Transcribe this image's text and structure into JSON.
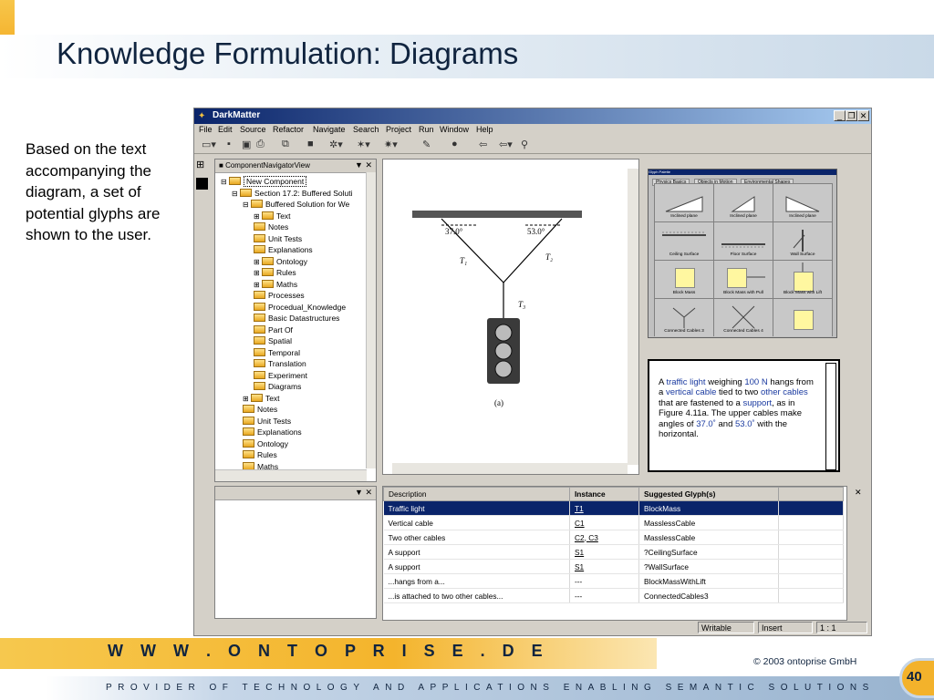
{
  "slide": {
    "title": "Knowledge Formulation: Diagrams",
    "description": "Based on the text accompanying the diagram, a set of potential glyphs are shown to the user.",
    "footer_url": "W W W . O N T O P R I S E . D E",
    "copyright": "©  2003  ontoprise GmbH",
    "tagline": "PROVIDER OF TECHNOLOGY AND APPLICATIONS ENABLING SEMANTIC SOLUTIONS",
    "page_number": "40"
  },
  "app": {
    "title": "DarkMatter",
    "menu": [
      "File",
      "Edit",
      "Source",
      "Refactor",
      "Navigate",
      "Search",
      "Project",
      "Run",
      "Window",
      "Help"
    ],
    "navigator": {
      "title": "ComponentNavigatorView",
      "tree": [
        {
          "label": "New Component",
          "level": 0,
          "selected": true
        },
        {
          "label": "Section 17.2: Buffered Soluti",
          "level": 1
        },
        {
          "label": "Buffered Solution for We",
          "level": 2
        },
        {
          "label": "Text",
          "level": 3
        },
        {
          "label": "Notes",
          "level": 3
        },
        {
          "label": "Unit Tests",
          "level": 3
        },
        {
          "label": "Explanations",
          "level": 3
        },
        {
          "label": "Ontology",
          "level": 3
        },
        {
          "label": "Rules",
          "level": 3
        },
        {
          "label": "Maths",
          "level": 3
        },
        {
          "label": "Processes",
          "level": 3
        },
        {
          "label": "Procedual_Knowledge",
          "level": 3
        },
        {
          "label": "Basic Datastructures",
          "level": 3
        },
        {
          "label": "Part Of",
          "level": 3
        },
        {
          "label": "Spatial",
          "level": 3
        },
        {
          "label": "Temporal",
          "level": 3
        },
        {
          "label": "Translation",
          "level": 3
        },
        {
          "label": "Experiment",
          "level": 3
        },
        {
          "label": "Diagrams",
          "level": 3
        },
        {
          "label": "Text",
          "level": 2
        },
        {
          "label": "Notes",
          "level": 2
        },
        {
          "label": "Unit Tests",
          "level": 2
        },
        {
          "label": "Explanations",
          "level": 2
        },
        {
          "label": "Ontology",
          "level": 2
        },
        {
          "label": "Rules",
          "level": 2
        },
        {
          "label": "Maths",
          "level": 2
        }
      ]
    },
    "diagram": {
      "angle_left": "37.0°",
      "angle_right": "53.0°",
      "t1": "T₁",
      "t2": "T₂",
      "t3": "T₃",
      "caption": "(a)"
    },
    "palette": {
      "title": "Glyph Palette",
      "tabs": [
        "Physics Basics",
        "Objects in Motion",
        "Environmental Shapes"
      ],
      "glyphs": [
        "Inclined plane",
        "Inclined plane",
        "Inclined plane",
        "Ceiling Surface",
        "Floor Surface",
        "Wall Surface",
        "Block Mass",
        "Block Mass with Pull",
        "Block Mass with Lift",
        "Connected Cables 3",
        "Connected Cables 4",
        ""
      ]
    },
    "text_panel": {
      "p1": "A ",
      "h1": "traffic light",
      "p2": " weighing ",
      "h2": "100 N",
      "p3": " hangs from a ",
      "h3": "vertical cable",
      "p4": " tied to two ",
      "h4": "other cables",
      "p5": " that are fastened to a ",
      "h5": "support",
      "p6": ", as in Figure 4.11a. The upper cables make angles of ",
      "h6": "37.0˚",
      "p7": " and ",
      "h7": "53.0˚",
      "p8": " with the horizontal."
    },
    "table": {
      "headers": [
        "Description",
        "Instance",
        "Suggested Glyph(s)"
      ],
      "rows": [
        [
          "Traffic light",
          "T1",
          "BlockMass"
        ],
        [
          "Vertical cable",
          "C1",
          "MasslessCable"
        ],
        [
          "Two other cables",
          "C2, C3",
          "MasslessCable"
        ],
        [
          "A support",
          "S1",
          "?CeilingSurface"
        ],
        [
          "A support",
          "S1",
          "?WallSurface"
        ],
        [
          "...hangs from a...",
          "---",
          "BlockMassWithLift"
        ],
        [
          "...is attached to two other cables...",
          "---",
          "ConnectedCables3"
        ]
      ]
    },
    "status": {
      "mode": "Writable",
      "insert": "Insert",
      "position": "1 : 1"
    }
  }
}
